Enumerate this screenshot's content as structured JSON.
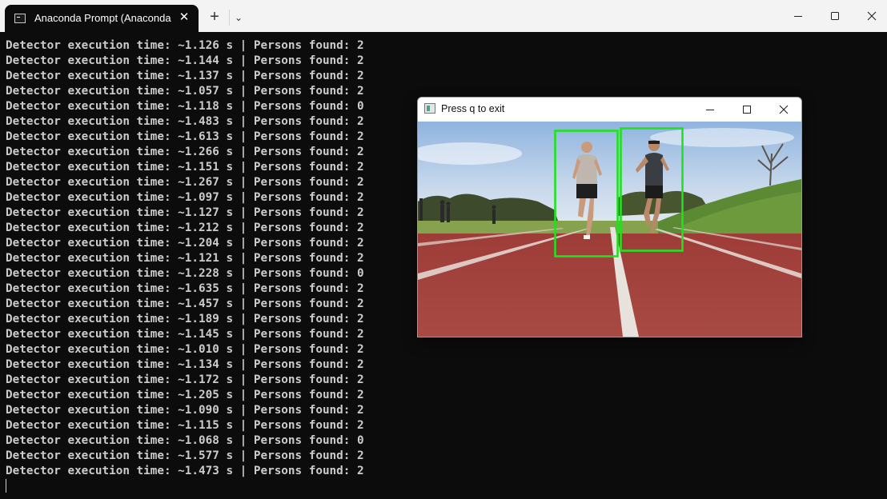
{
  "tab": {
    "title": "Anaconda Prompt (Anaconda",
    "close_glyph": "✕",
    "new_tab_glyph": "+",
    "dropdown_glyph": "⌄",
    "icon": "terminal-icon"
  },
  "window_controls": [
    "minimize-icon",
    "maximize-icon",
    "close-icon"
  ],
  "terminal": {
    "lines": [
      "Detector execution time: ~1.126 s | Persons found: 2",
      "Detector execution time: ~1.144 s | Persons found: 2",
      "Detector execution time: ~1.137 s | Persons found: 2",
      "Detector execution time: ~1.057 s | Persons found: 2",
      "Detector execution time: ~1.118 s | Persons found: 0",
      "Detector execution time: ~1.483 s | Persons found: 2",
      "Detector execution time: ~1.613 s | Persons found: 2",
      "Detector execution time: ~1.266 s | Persons found: 2",
      "Detector execution time: ~1.151 s | Persons found: 2",
      "Detector execution time: ~1.267 s | Persons found: 2",
      "Detector execution time: ~1.097 s | Persons found: 2",
      "Detector execution time: ~1.127 s | Persons found: 2",
      "Detector execution time: ~1.212 s | Persons found: 2",
      "Detector execution time: ~1.204 s | Persons found: 2",
      "Detector execution time: ~1.121 s | Persons found: 2",
      "Detector execution time: ~1.228 s | Persons found: 0",
      "Detector execution time: ~1.635 s | Persons found: 2",
      "Detector execution time: ~1.457 s | Persons found: 2",
      "Detector execution time: ~1.189 s | Persons found: 2",
      "Detector execution time: ~1.145 s | Persons found: 2",
      "Detector execution time: ~1.010 s | Persons found: 2",
      "Detector execution time: ~1.134 s | Persons found: 2",
      "Detector execution time: ~1.172 s | Persons found: 2",
      "Detector execution time: ~1.205 s | Persons found: 2",
      "Detector execution time: ~1.090 s | Persons found: 2",
      "Detector execution time: ~1.115 s | Persons found: 2",
      "Detector execution time: ~1.068 s | Persons found: 0",
      "Detector execution time: ~1.577 s | Persons found: 2",
      "Detector execution time: ~1.473 s | Persons found: 2"
    ]
  },
  "popup": {
    "title": "Press q to exit",
    "detection_count": 2,
    "box_color": "#22e022"
  },
  "colors": {
    "terminal_bg": "#0c0c0c",
    "terminal_text": "#cccccc",
    "titlebar_bg": "#f3f3f3",
    "track": "#a53a36",
    "box": "#22e022"
  }
}
